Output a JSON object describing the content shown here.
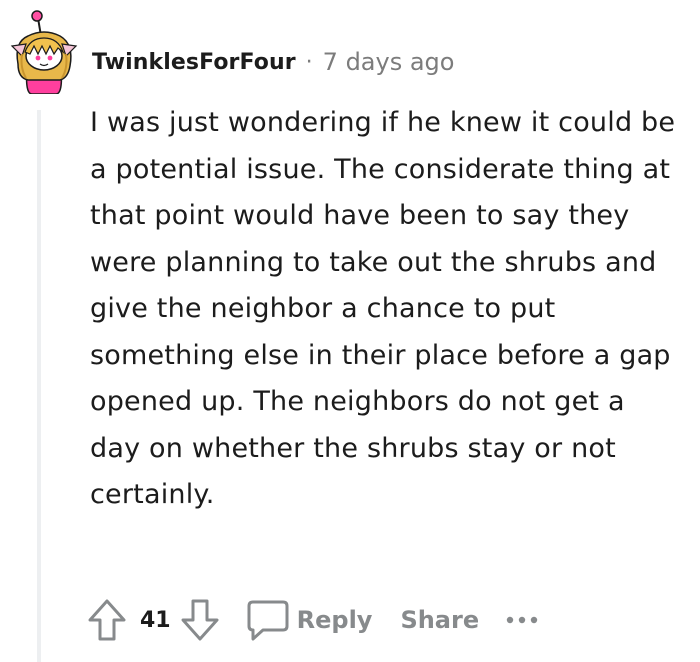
{
  "comment": {
    "author": "TwinklesForFour",
    "separator": "·",
    "timestamp": "7 days ago",
    "body": "I was just wondering if he knew it could be a potential issue. The considerate thing at that point would have been to say they were planning to take out the shrubs and give the neighbor a chance to put something else in their place before a gap opened up. The neighbors do not get a day on whether the shrubs stay or not certainly.",
    "avatar_icon": "snoo-avatar-icon"
  },
  "actions": {
    "upvote_icon": "upvote-arrow-icon",
    "vote_count": "41",
    "downvote_icon": "downvote-arrow-icon",
    "reply_icon": "comment-bubble-icon",
    "reply_label": "Reply",
    "share_label": "Share",
    "more_icon": "ellipsis-icon"
  },
  "colors": {
    "text": "#1c1c1c",
    "meta": "#7c7c7c",
    "action": "#878a8c",
    "thread_line": "#edeff1",
    "avatar_pink": "#ff4fa3"
  }
}
